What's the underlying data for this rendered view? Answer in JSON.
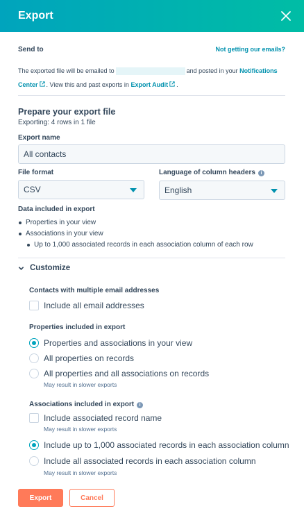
{
  "header": {
    "title": "Export"
  },
  "send_to": {
    "label": "Send to",
    "help_link": "Not getting our emails?",
    "text_before": "The exported file will be emailed to",
    "text_middle": "and posted in your",
    "notifications_link_1": "Notifications",
    "notifications_link_2": "Center",
    "text_after": ". View this and past exports in",
    "export_audit_link": "Export Audit",
    "text_end": "."
  },
  "prepare": {
    "title": "Prepare your export file",
    "subtitle": "Exporting:  4 rows in 1 file"
  },
  "export_name": {
    "label": "Export name",
    "value": "All contacts"
  },
  "file_format": {
    "label": "File format",
    "value": "CSV"
  },
  "language": {
    "label": "Language of column headers",
    "value": "English"
  },
  "data_included": {
    "label": "Data included in export",
    "items": [
      "Properties in your view",
      "Associations in your view"
    ],
    "subitem": "Up to 1,000 associated records in each association column of each row"
  },
  "customize": {
    "label": "Customize",
    "emails": {
      "heading": "Contacts with multiple email addresses",
      "option": "Include all email addresses"
    },
    "properties": {
      "heading": "Properties included in export",
      "options": [
        "Properties and associations in your view",
        "All properties on records",
        "All properties and all associations on records"
      ],
      "hint": "May result in slower exports",
      "selected": 0
    },
    "associations": {
      "heading": "Associations included in export",
      "option_name": "Include associated record name",
      "option_name_hint": "May result in slower exports",
      "options": [
        "Include up to 1,000 associated records in each association column",
        "Include all associated records in each association column"
      ],
      "hint": "May result in slower exports",
      "selected": 0
    }
  },
  "footer": {
    "export_label": "Export",
    "cancel_label": "Cancel"
  },
  "colors": {
    "header_start": "#00a4bd",
    "header_end": "#00bda5",
    "accent": "#ff7a59",
    "link": "#0091ae"
  }
}
